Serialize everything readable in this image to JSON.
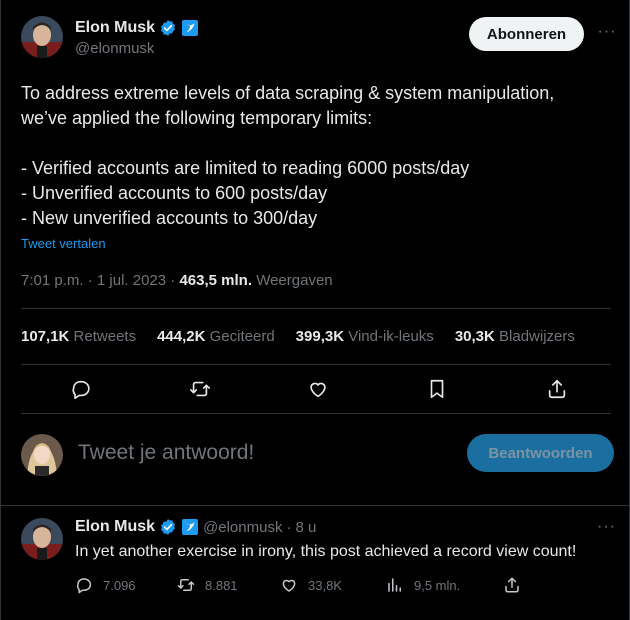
{
  "main_tweet": {
    "author": {
      "display_name": "Elon Musk",
      "handle": "@elonmusk",
      "verified_badge_icon": "blue-check-icon",
      "affiliate_badge_icon": "x-logo-badge-icon"
    },
    "subscribe_label": "Abonneren",
    "more_label": "···",
    "body_lines": [
      "To address extreme levels of data scraping & system manipulation,",
      "we’ve applied the following temporary limits:",
      "",
      "- Verified accounts are limited to reading 6000 posts/day",
      "- Unverified accounts to 600 posts/day",
      "- New unverified accounts to 300/day"
    ],
    "translate_label": "Tweet vertalen",
    "meta": {
      "time": "7:01 p.m.",
      "date": "1 jul. 2023",
      "separator": "·",
      "views_count": "463,5 mln.",
      "views_label": "Weergaven"
    },
    "stats": [
      {
        "num": "107,1K",
        "label": "Retweets"
      },
      {
        "num": "444,2K",
        "label": "Geciteerd"
      },
      {
        "num": "399,3K",
        "label": "Vind-ik-leuks"
      },
      {
        "num": "30,3K",
        "label": "Bladwijzers"
      }
    ],
    "actions": [
      "reply-icon",
      "retweet-icon",
      "like-icon",
      "bookmark-icon",
      "share-icon"
    ]
  },
  "reply_composer": {
    "placeholder": "Tweet je antwoord!",
    "button_label": "Beantwoorden"
  },
  "reply_tweet": {
    "display_name": "Elon Musk",
    "handle": "@elonmusk",
    "separator": "·",
    "time": "8 u",
    "more_label": "···",
    "text": "In yet another exercise in irony, this post achieved a record view count!",
    "actions": [
      {
        "icon": "reply-icon",
        "count": "7.096"
      },
      {
        "icon": "retweet-icon",
        "count": "8.881"
      },
      {
        "icon": "like-icon",
        "count": "33,8K"
      },
      {
        "icon": "views-icon",
        "count": "9,5 mln."
      },
      {
        "icon": "share-icon",
        "count": ""
      }
    ]
  },
  "colors": {
    "background": "#000000",
    "text": "#e7e9ea",
    "muted": "#71767b",
    "accent": "#1d9bf0",
    "border": "#2f3336"
  }
}
